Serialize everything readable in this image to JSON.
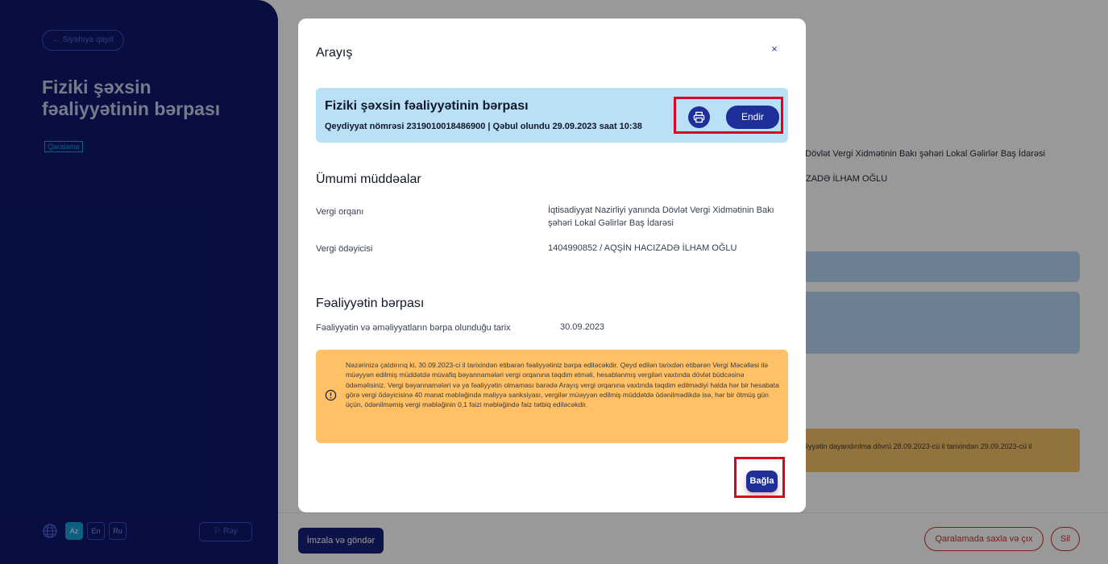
{
  "background": {
    "back_label": "← Siyahıya qayıt",
    "page_title": "Fiziki şəxsin fəaliyyətinin bərpası",
    "status_badge": "Qaralama",
    "languages": [
      "Az",
      "En",
      "Ru"
    ],
    "active_language": "Az",
    "feedback_label": "Rəy",
    "tax_authority_partial": "a Dövlət Vergi Xidmətinin Bakı şəhəri Lokal Gəlirlər Baş İdarəsi",
    "taxpayer_partial": "ZADƏ İLHAM OĞLU",
    "notice_partial": "liyyətin dayandırılma dövrü 28.09.2023-cü il tarixindən 29.09.2023-cü il",
    "sign_button": "İmzala və göndər",
    "save_exit_button": "Qaralamada saxla və çıx",
    "delete_button": "Sil"
  },
  "modal": {
    "title": "Arayış",
    "close_symbol": "×",
    "header": {
      "title": "Fiziki şəxsin fəaliyyətinin bərpası",
      "subtitle": "Qeydiyyat nömrəsi 2319010018486900 | Qəbul olundu 29.09.2023 saat 10:38",
      "download_label": "Endir"
    },
    "general": {
      "title": "Ümumi müddəalar",
      "rows": [
        {
          "label": "Vergi orqanı",
          "value": "İqtisadiyyat Nazirliyi yanında Dövlət Vergi Xidmətinin Bakı şəhəri Lokal Gəlirlər Baş İdarəsi"
        },
        {
          "label": "Vergi ödəyicisi",
          "value": "1404990852 / AQŞİN HACIZADƏ İLHAM OĞLU"
        }
      ]
    },
    "restoration": {
      "title": "Fəaliyyətin bərpası",
      "rows": [
        {
          "label": "Fəaliyyətin və əməliyyatların bərpa olunduğu tarix",
          "value": "30.09.2023"
        }
      ]
    },
    "warning_text": "Nəzərinizə çatdırırıq ki, 30.09.2023-ci il tarixindən etibarən fəaliyyətiniz bərpa ediləcəkdir. Qeyd edilən tarixdən etibarən Vergi Məcəlləsi ilə müəyyən edilmiş müddətdə müvafiq bəyannamələri vergi orqanına təqdim etməli, hesablanmış vergiləri vaxtında dövlət büdcəsinə ödəməlisiniz. Vergi bəyannamələri və ya fəaliyyətin olmaması barədə Arayış vergi orqanına vaxtında təqdim edilmədiyi halda hər bir hesabata görə vergi ödəyicisinə 40 manat məbləğində maliyyə sanksiyası, vergilər müəyyən edilmiş müddətdə ödənilmədikdə isə, hər bir ötmüş gün üçün, ödənilməmiş vergi məbləğinin 0,1 faizi məbləğində faiz tətbiq ediləcəkdir.",
    "close_button": "Bağla"
  },
  "colors": {
    "navy": "#0e1a6b",
    "primary_button": "#1f2f9a",
    "header_card": "#b9e0f7",
    "warning": "#ffc066",
    "highlight": "#e0001b"
  }
}
